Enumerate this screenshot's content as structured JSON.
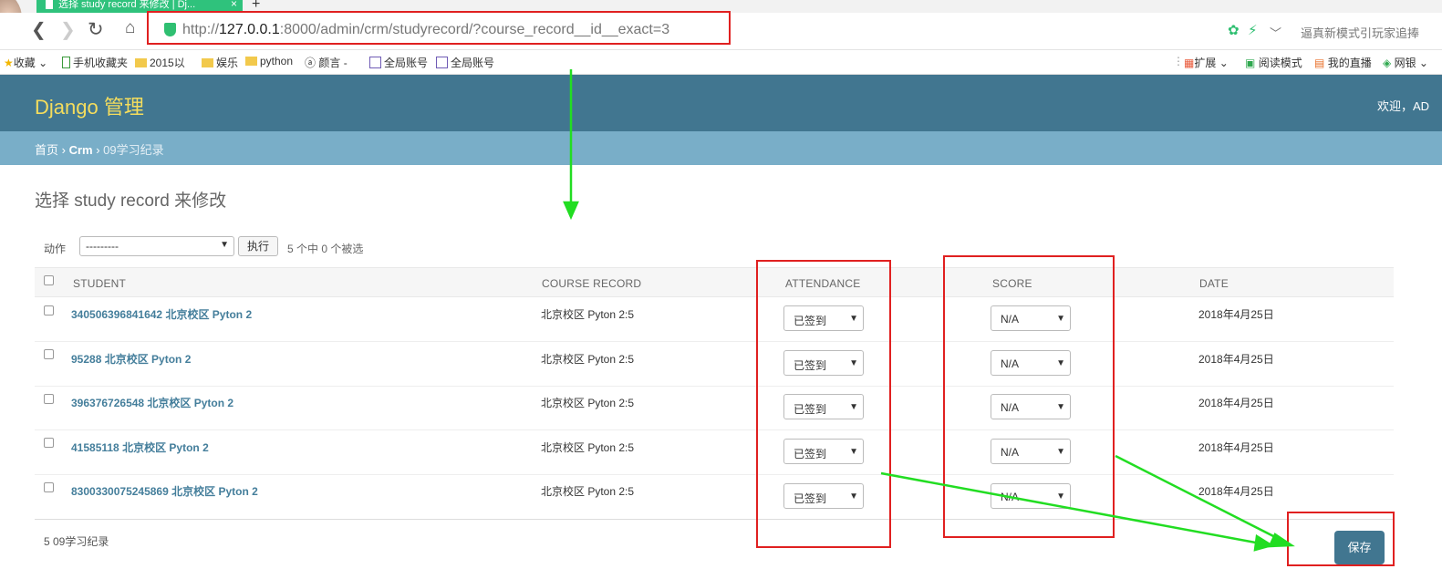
{
  "browser": {
    "tab_title": "选择 study record 来修改 | Dj...",
    "tab_close": "×",
    "new_tab": "+",
    "url_scheme": "http://",
    "url_host": "127.0.0.1",
    "url_rest": ":8000/admin/crm/studyrecord/?course_record__id__exact=3",
    "search_hint": "逼真新模式引玩家追捧",
    "bookmarks": [
      "收藏",
      "手机收藏夹",
      "2015以",
      "娱乐",
      "python",
      "颜言 -",
      "全局账号",
      "全局账号"
    ],
    "right_bookmarks": [
      "扩展",
      "阅读模式",
      "我的直播",
      "网银"
    ]
  },
  "admin": {
    "brand": "Django 管理",
    "welcome": "欢迎，AD",
    "breadcrumb": {
      "home": "首页",
      "app": "Crm",
      "current": "09学习纪录",
      "sep": " › "
    },
    "page_title": "选择 study record 来修改",
    "actions": {
      "label": "动作",
      "selected": "---------",
      "run": "执行",
      "counter": "5 个中 0 个被选"
    },
    "columns": [
      "STUDENT",
      "COURSE RECORD",
      "ATTENDANCE",
      "SCORE",
      "DATE"
    ],
    "rows": [
      {
        "student": "340506396841642 北京校区 Pyton 2",
        "course": "北京校区 Pyton 2:5",
        "attendance": "已签到",
        "score": "N/A",
        "date": "2018年4月25日"
      },
      {
        "student": "95288 北京校区 Pyton 2",
        "course": "北京校区 Pyton 2:5",
        "attendance": "已签到",
        "score": "N/A",
        "date": "2018年4月25日"
      },
      {
        "student": "396376726548 北京校区 Pyton 2",
        "course": "北京校区 Pyton 2:5",
        "attendance": "已签到",
        "score": "N/A",
        "date": "2018年4月25日"
      },
      {
        "student": "41585118 北京校区 Pyton 2",
        "course": "北京校区 Pyton 2:5",
        "attendance": "已签到",
        "score": "N/A",
        "date": "2018年4月25日"
      },
      {
        "student": "8300330075245869 北京校区 Pyton 2",
        "course": "北京校区 Pyton 2:5",
        "attendance": "已签到",
        "score": "N/A",
        "date": "2018年4月25日"
      }
    ],
    "footer_count": "5 09学习纪录",
    "save": "保存"
  },
  "colors": {
    "header": "#417690",
    "breadcrumb": "#79aec8",
    "brand": "#f5dd5d",
    "link": "#447e9b",
    "annotation_red": "#e02020",
    "annotation_green": "#22dd22"
  }
}
